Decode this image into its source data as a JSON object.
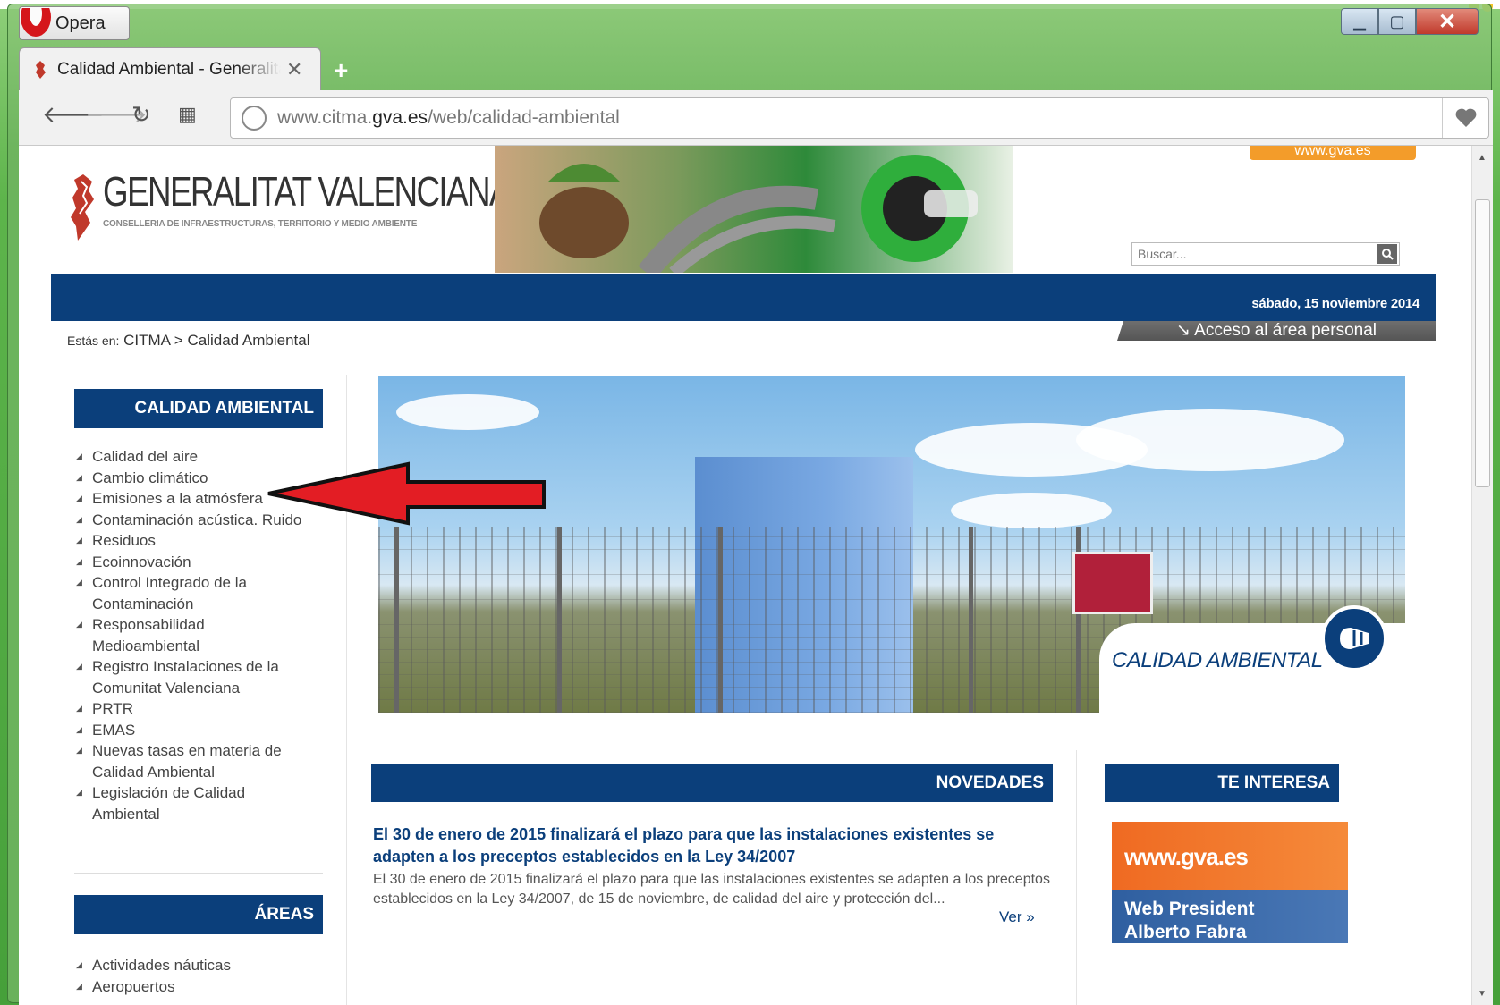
{
  "browser": {
    "app_label": "Opera",
    "tab_title": "Calidad Ambiental - Generalitat",
    "url_prefix": "www.citma.",
    "url_domain": "gva.es",
    "url_suffix": "/web/calidad-ambiental"
  },
  "site": {
    "logo_main": "GENERALITAT VALENCIANA",
    "logo_sub": "CONSELLERIA DE INFRAESTRUCTURAS, TERRITORIO Y MEDIO AMBIENTE",
    "gva_link": "www.gva.es",
    "search_placeholder": "Buscar...",
    "date": "sábado, 15 noviembre 2014",
    "acceso": "↘ Acceso al área personal",
    "breadcrumb_label": "Estás en:",
    "breadcrumb_items": [
      "CITMA",
      ">",
      "Calidad Ambiental"
    ]
  },
  "sidebar": {
    "header": "CALIDAD AMBIENTAL",
    "items": [
      "Calidad del aire",
      "Cambio climático",
      "Emisiones a la atmósfera",
      "Contaminación acústica. Ruido",
      "Residuos",
      "Ecoinnovación",
      "Control Integrado de la Contaminación",
      "Responsabilidad Medioambiental",
      "Registro Instalaciones de la Comunitat Valenciana",
      "PRTR",
      "EMAS",
      "Nuevas tasas en materia de Calidad Ambiental",
      "Legislación de Calidad Ambiental"
    ],
    "areas_header": "ÁREAS",
    "areas_items": [
      "Actividades náuticas",
      "Aeropuertos"
    ]
  },
  "hero": {
    "label": "CALIDAD AMBIENTAL"
  },
  "novedades": {
    "header": "NOVEDADES",
    "title": "El 30 de enero de 2015 finalizará el plazo para que las instalaciones existentes se adapten a los preceptos establecidos en la Ley 34/2007",
    "body": "El 30 de enero de 2015 finalizará el plazo para que las instalaciones existentes se adapten a los preceptos establecidos en la Ley 34/2007, de 15 de noviembre, de calidad del aire y protección del...",
    "more": "Ver »"
  },
  "te_interesa": {
    "header": "TE INTERESA",
    "promo1": "www.gva.es",
    "promo2_line1": "Web President",
    "promo2_line2": "Alberto Fabra"
  },
  "colors": {
    "brand_blue": "#0b3f7b",
    "accent_orange": "#f39c2a",
    "arrow_red": "#e31d24"
  }
}
